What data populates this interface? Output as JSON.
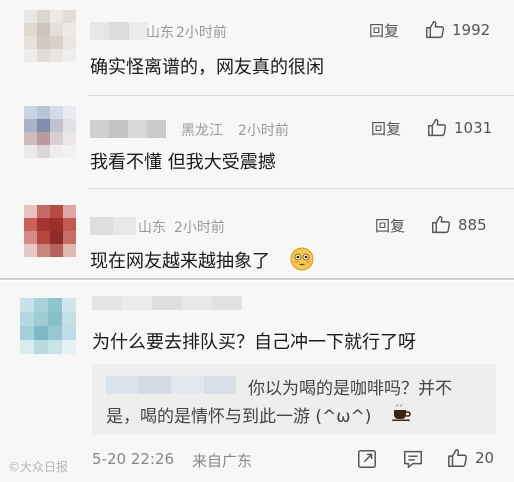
{
  "comments": [
    {
      "location": "山东",
      "time": "2小时前",
      "reply_label": "回复",
      "likes": "1992",
      "text": "确实怪离谱的，网友真的很闲"
    },
    {
      "location": "黑龙江",
      "time": "2小时前",
      "reply_label": "回复",
      "likes": "1031",
      "text": "我看不懂 但我大受震撼"
    },
    {
      "location": "山东",
      "time": "2小时前",
      "reply_label": "回复",
      "likes": "885",
      "text": "现在网友越来越抽象了",
      "emoji": "😳"
    }
  ],
  "main_comment": {
    "text": "为什么要去排队买？自己冲一下就行了呀",
    "quote_line1": "你以为喝的是咖啡吗？并不",
    "quote_line2": "是，喝的是情怀与到此一游 (^ω^)",
    "quote_emoji": "☕",
    "date": "5-20 22:26",
    "location": "来自广东",
    "likes": "20"
  },
  "watermark": "©大众日报",
  "icons": [
    "thumbs-up-icon",
    "share-icon",
    "comment-icon",
    "coffee-icon",
    "flushed-face-icon"
  ],
  "colors": {
    "meta": "#9a9a9a",
    "text": "#1a1a1a",
    "card_bg": "#f7f7f7",
    "quote_bg": "#eeeeee"
  }
}
